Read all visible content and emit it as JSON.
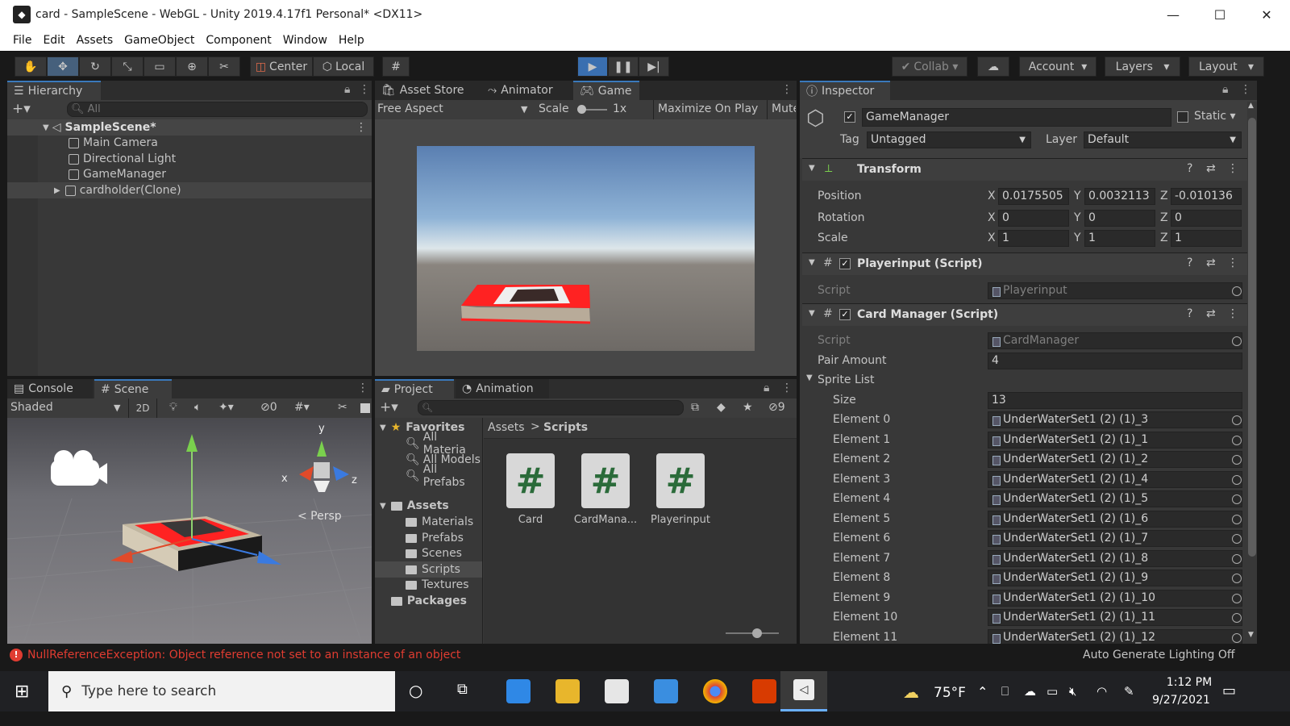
{
  "window": {
    "title": "card - SampleScene - WebGL - Unity 2019.4.17f1 Personal* <DX11>",
    "min": "—",
    "max": "☐",
    "close": "✕"
  },
  "menu": [
    "File",
    "Edit",
    "Assets",
    "GameObject",
    "Component",
    "Window",
    "Help"
  ],
  "toolbar": {
    "center": "Center",
    "local": "Local",
    "collab": "Collab",
    "account": "Account",
    "layers": "Layers",
    "layout": "Layout"
  },
  "hierarchy": {
    "tab": "Hierarchy",
    "search_placeholder": "All",
    "scene": "SampleScene*",
    "items": [
      "Main Camera",
      "Directional Light",
      "GameManager",
      "cardholder(Clone)"
    ]
  },
  "game": {
    "tabs": [
      "Asset Store",
      "Animator",
      "Game"
    ],
    "aspect": "Free Aspect",
    "scale_label": "Scale",
    "scale_value": "1x",
    "maximize": "Maximize On Play",
    "mute": "Mute"
  },
  "scene": {
    "tabs": [
      "Console",
      "Scene"
    ],
    "shading": "Shaded",
    "mode2d": "2D",
    "hidden_count": "0",
    "persp": "< Persp",
    "axes": {
      "x": "x",
      "y": "y",
      "z": "z"
    }
  },
  "project": {
    "tabs": [
      "Project",
      "Animation"
    ],
    "hidden_count": "9",
    "favorites": "Favorites",
    "fav_items": [
      "All Materia",
      "All Models",
      "All Prefabs"
    ],
    "assets": "Assets",
    "folders": [
      "Materials",
      "Prefabs",
      "Scenes",
      "Scripts",
      "Textures"
    ],
    "packages": "Packages",
    "breadcrumb": [
      "Assets",
      "Scripts"
    ],
    "files": [
      {
        "name": "Card"
      },
      {
        "name": "CardMana..."
      },
      {
        "name": "Playerinput"
      }
    ]
  },
  "inspector": {
    "tab": "Inspector",
    "object_name": "GameManager",
    "static": "Static",
    "tag_label": "Tag",
    "tag_value": "Untagged",
    "layer_label": "Layer",
    "layer_value": "Default",
    "transform": {
      "title": "Transform",
      "position_label": "Position",
      "position": {
        "x": "0.0175505",
        "y": "0.0032113",
        "z": "-0.010136"
      },
      "rotation_label": "Rotation",
      "rotation": {
        "x": "0",
        "y": "0",
        "z": "0"
      },
      "scale_label": "Scale",
      "scale": {
        "x": "1",
        "y": "1",
        "z": "1"
      }
    },
    "playerinput": {
      "title": "Playerinput (Script)",
      "script_label": "Script",
      "script_value": "Playerinput"
    },
    "cardmanager": {
      "title": "Card Manager (Script)",
      "script_label": "Script",
      "script_value": "CardManager",
      "pair_label": "Pair Amount",
      "pair_value": "4",
      "sprite_list": "Sprite List",
      "size_label": "Size",
      "size_value": "13",
      "elements": [
        {
          "label": "Element 0",
          "value": "UnderWaterSet1 (2) (1)_3"
        },
        {
          "label": "Element 1",
          "value": "UnderWaterSet1 (2) (1)_1"
        },
        {
          "label": "Element 2",
          "value": "UnderWaterSet1 (2) (1)_2"
        },
        {
          "label": "Element 3",
          "value": "UnderWaterSet1 (2) (1)_4"
        },
        {
          "label": "Element 4",
          "value": "UnderWaterSet1 (2) (1)_5"
        },
        {
          "label": "Element 5",
          "value": "UnderWaterSet1 (2) (1)_6"
        },
        {
          "label": "Element 6",
          "value": "UnderWaterSet1 (2) (1)_7"
        },
        {
          "label": "Element 7",
          "value": "UnderWaterSet1 (2) (1)_8"
        },
        {
          "label": "Element 8",
          "value": "UnderWaterSet1 (2) (1)_9"
        },
        {
          "label": "Element 9",
          "value": "UnderWaterSet1 (2) (1)_10"
        },
        {
          "label": "Element 10",
          "value": "UnderWaterSet1 (2) (1)_11"
        },
        {
          "label": "Element 11",
          "value": "UnderWaterSet1 (2) (1)_12"
        }
      ]
    }
  },
  "status": {
    "error": "NullReferenceException: Object reference not set to an instance of an object",
    "lighting": "Auto Generate Lighting Off"
  },
  "taskbar": {
    "search_placeholder": "Type here to search",
    "weather": "75°F",
    "time": "1:12 PM",
    "date": "9/27/2021"
  }
}
